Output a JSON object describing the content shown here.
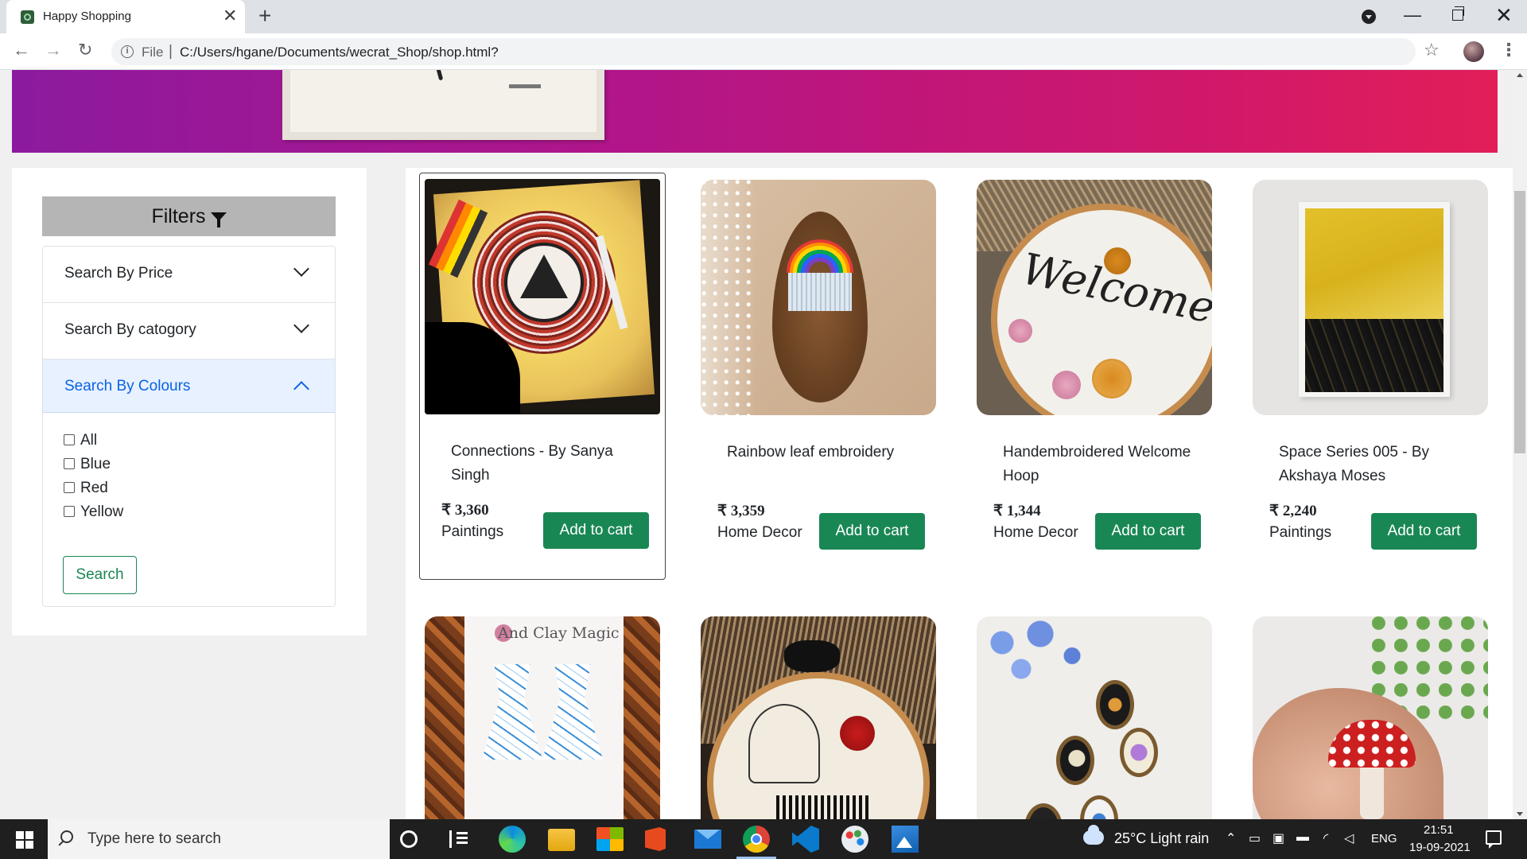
{
  "browser": {
    "tab_title": "Happy Shopping",
    "tab_close": "✕",
    "new_tab": "+",
    "url_scheme": "File",
    "url_separator": "|",
    "url": "C:/Users/hgane/Documents/wecrat_Shop/shop.html?",
    "back": "←",
    "forward": "→",
    "reload": "↻",
    "star": "☆",
    "menu": "⋮",
    "minimize": "—",
    "close": "✕"
  },
  "sidebar": {
    "filters_title": "Filters",
    "sections": [
      {
        "label": "Search By Price",
        "expanded": false
      },
      {
        "label": "Search By catogory",
        "expanded": false
      },
      {
        "label": "Search By Colours",
        "expanded": true
      }
    ],
    "colour_options": [
      "All",
      "Blue",
      "Red",
      "Yellow"
    ],
    "search_button": "Search"
  },
  "products": [
    {
      "title": "Connections - By Sanya Singh",
      "price": "₹ 3,360",
      "category": "Paintings",
      "button": "Add to cart"
    },
    {
      "title": "Rainbow leaf embroidery",
      "price": "₹ 3,359",
      "category": "Home Decor",
      "button": "Add to cart"
    },
    {
      "title": "Handembroidered Welcome Hoop",
      "price": "₹ 1,344",
      "category": "Home Decor",
      "button": "Add to cart"
    },
    {
      "title": "Space Series 005 - By Akshaya Moses",
      "price": "₹ 2,240",
      "category": "Paintings",
      "button": "Add to cart"
    }
  ],
  "second_row_image_text": {
    "earrings_brand": "And Clay Magic"
  },
  "taskbar": {
    "search_placeholder": "Type here to search",
    "weather": "25°C  Light rain",
    "language": "ENG",
    "time": "21:51",
    "date": "19-09-2021"
  },
  "colors": {
    "accent_green": "#198754",
    "accordion_active_bg": "#e7f1ff",
    "accordion_active_text": "#0c63e4",
    "banner_gradient_start": "#8c1a9e",
    "banner_gradient_end": "#e21e58",
    "filters_header_bg": "#b5b5b5"
  }
}
